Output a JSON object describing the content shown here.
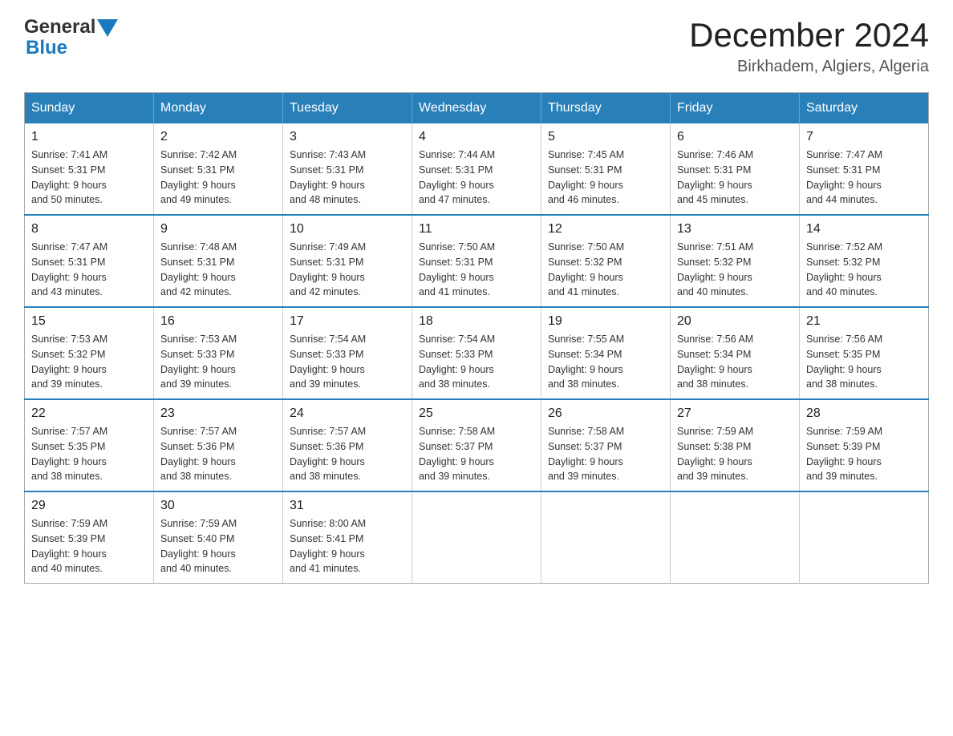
{
  "header": {
    "logo_general": "General",
    "logo_blue": "Blue",
    "month_title": "December 2024",
    "location": "Birkhadem, Algiers, Algeria"
  },
  "days_of_week": [
    "Sunday",
    "Monday",
    "Tuesday",
    "Wednesday",
    "Thursday",
    "Friday",
    "Saturday"
  ],
  "weeks": [
    [
      {
        "day": "1",
        "sunrise": "Sunrise: 7:41 AM",
        "sunset": "Sunset: 5:31 PM",
        "daylight": "Daylight: 9 hours",
        "minutes": "and 50 minutes."
      },
      {
        "day": "2",
        "sunrise": "Sunrise: 7:42 AM",
        "sunset": "Sunset: 5:31 PM",
        "daylight": "Daylight: 9 hours",
        "minutes": "and 49 minutes."
      },
      {
        "day": "3",
        "sunrise": "Sunrise: 7:43 AM",
        "sunset": "Sunset: 5:31 PM",
        "daylight": "Daylight: 9 hours",
        "minutes": "and 48 minutes."
      },
      {
        "day": "4",
        "sunrise": "Sunrise: 7:44 AM",
        "sunset": "Sunset: 5:31 PM",
        "daylight": "Daylight: 9 hours",
        "minutes": "and 47 minutes."
      },
      {
        "day": "5",
        "sunrise": "Sunrise: 7:45 AM",
        "sunset": "Sunset: 5:31 PM",
        "daylight": "Daylight: 9 hours",
        "minutes": "and 46 minutes."
      },
      {
        "day": "6",
        "sunrise": "Sunrise: 7:46 AM",
        "sunset": "Sunset: 5:31 PM",
        "daylight": "Daylight: 9 hours",
        "minutes": "and 45 minutes."
      },
      {
        "day": "7",
        "sunrise": "Sunrise: 7:47 AM",
        "sunset": "Sunset: 5:31 PM",
        "daylight": "Daylight: 9 hours",
        "minutes": "and 44 minutes."
      }
    ],
    [
      {
        "day": "8",
        "sunrise": "Sunrise: 7:47 AM",
        "sunset": "Sunset: 5:31 PM",
        "daylight": "Daylight: 9 hours",
        "minutes": "and 43 minutes."
      },
      {
        "day": "9",
        "sunrise": "Sunrise: 7:48 AM",
        "sunset": "Sunset: 5:31 PM",
        "daylight": "Daylight: 9 hours",
        "minutes": "and 42 minutes."
      },
      {
        "day": "10",
        "sunrise": "Sunrise: 7:49 AM",
        "sunset": "Sunset: 5:31 PM",
        "daylight": "Daylight: 9 hours",
        "minutes": "and 42 minutes."
      },
      {
        "day": "11",
        "sunrise": "Sunrise: 7:50 AM",
        "sunset": "Sunset: 5:31 PM",
        "daylight": "Daylight: 9 hours",
        "minutes": "and 41 minutes."
      },
      {
        "day": "12",
        "sunrise": "Sunrise: 7:50 AM",
        "sunset": "Sunset: 5:32 PM",
        "daylight": "Daylight: 9 hours",
        "minutes": "and 41 minutes."
      },
      {
        "day": "13",
        "sunrise": "Sunrise: 7:51 AM",
        "sunset": "Sunset: 5:32 PM",
        "daylight": "Daylight: 9 hours",
        "minutes": "and 40 minutes."
      },
      {
        "day": "14",
        "sunrise": "Sunrise: 7:52 AM",
        "sunset": "Sunset: 5:32 PM",
        "daylight": "Daylight: 9 hours",
        "minutes": "and 40 minutes."
      }
    ],
    [
      {
        "day": "15",
        "sunrise": "Sunrise: 7:53 AM",
        "sunset": "Sunset: 5:32 PM",
        "daylight": "Daylight: 9 hours",
        "minutes": "and 39 minutes."
      },
      {
        "day": "16",
        "sunrise": "Sunrise: 7:53 AM",
        "sunset": "Sunset: 5:33 PM",
        "daylight": "Daylight: 9 hours",
        "minutes": "and 39 minutes."
      },
      {
        "day": "17",
        "sunrise": "Sunrise: 7:54 AM",
        "sunset": "Sunset: 5:33 PM",
        "daylight": "Daylight: 9 hours",
        "minutes": "and 39 minutes."
      },
      {
        "day": "18",
        "sunrise": "Sunrise: 7:54 AM",
        "sunset": "Sunset: 5:33 PM",
        "daylight": "Daylight: 9 hours",
        "minutes": "and 38 minutes."
      },
      {
        "day": "19",
        "sunrise": "Sunrise: 7:55 AM",
        "sunset": "Sunset: 5:34 PM",
        "daylight": "Daylight: 9 hours",
        "minutes": "and 38 minutes."
      },
      {
        "day": "20",
        "sunrise": "Sunrise: 7:56 AM",
        "sunset": "Sunset: 5:34 PM",
        "daylight": "Daylight: 9 hours",
        "minutes": "and 38 minutes."
      },
      {
        "day": "21",
        "sunrise": "Sunrise: 7:56 AM",
        "sunset": "Sunset: 5:35 PM",
        "daylight": "Daylight: 9 hours",
        "minutes": "and 38 minutes."
      }
    ],
    [
      {
        "day": "22",
        "sunrise": "Sunrise: 7:57 AM",
        "sunset": "Sunset: 5:35 PM",
        "daylight": "Daylight: 9 hours",
        "minutes": "and 38 minutes."
      },
      {
        "day": "23",
        "sunrise": "Sunrise: 7:57 AM",
        "sunset": "Sunset: 5:36 PM",
        "daylight": "Daylight: 9 hours",
        "minutes": "and 38 minutes."
      },
      {
        "day": "24",
        "sunrise": "Sunrise: 7:57 AM",
        "sunset": "Sunset: 5:36 PM",
        "daylight": "Daylight: 9 hours",
        "minutes": "and 38 minutes."
      },
      {
        "day": "25",
        "sunrise": "Sunrise: 7:58 AM",
        "sunset": "Sunset: 5:37 PM",
        "daylight": "Daylight: 9 hours",
        "minutes": "and 39 minutes."
      },
      {
        "day": "26",
        "sunrise": "Sunrise: 7:58 AM",
        "sunset": "Sunset: 5:37 PM",
        "daylight": "Daylight: 9 hours",
        "minutes": "and 39 minutes."
      },
      {
        "day": "27",
        "sunrise": "Sunrise: 7:59 AM",
        "sunset": "Sunset: 5:38 PM",
        "daylight": "Daylight: 9 hours",
        "minutes": "and 39 minutes."
      },
      {
        "day": "28",
        "sunrise": "Sunrise: 7:59 AM",
        "sunset": "Sunset: 5:39 PM",
        "daylight": "Daylight: 9 hours",
        "minutes": "and 39 minutes."
      }
    ],
    [
      {
        "day": "29",
        "sunrise": "Sunrise: 7:59 AM",
        "sunset": "Sunset: 5:39 PM",
        "daylight": "Daylight: 9 hours",
        "minutes": "and 40 minutes."
      },
      {
        "day": "30",
        "sunrise": "Sunrise: 7:59 AM",
        "sunset": "Sunset: 5:40 PM",
        "daylight": "Daylight: 9 hours",
        "minutes": "and 40 minutes."
      },
      {
        "day": "31",
        "sunrise": "Sunrise: 8:00 AM",
        "sunset": "Sunset: 5:41 PM",
        "daylight": "Daylight: 9 hours",
        "minutes": "and 41 minutes."
      },
      null,
      null,
      null,
      null
    ]
  ]
}
